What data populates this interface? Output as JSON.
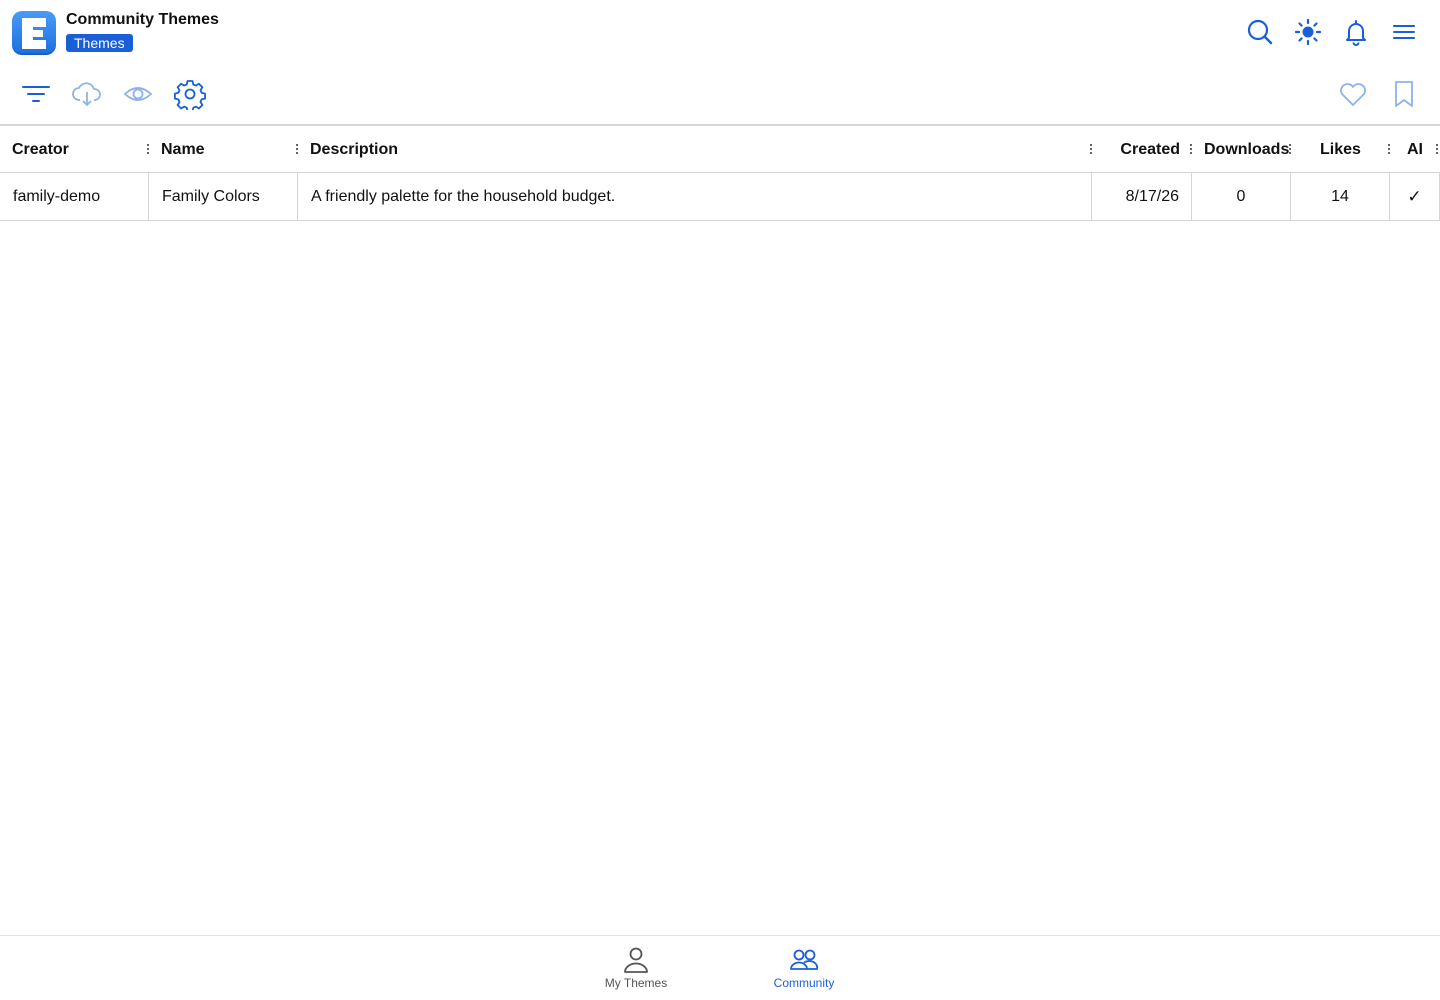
{
  "header": {
    "title": "Community Themes",
    "badge": "Themes",
    "icons": [
      "search-icon",
      "brightness-icon",
      "bell-icon",
      "hamburger-menu-icon"
    ]
  },
  "toolbar": {
    "left_icons": [
      "filter-icon",
      "cloud-download-icon",
      "eye-icon",
      "gear-icon"
    ],
    "right_icons": [
      "heart-icon",
      "bookmark-icon"
    ]
  },
  "table": {
    "columns": [
      "Creator",
      "Name",
      "Description",
      "Created",
      "Downloads",
      "Likes",
      "AI"
    ],
    "rows": [
      {
        "creator": "family-demo",
        "name": "Family Colors",
        "description": "A friendly palette for the household budget.",
        "created": "8/17/26",
        "downloads": "0",
        "likes": "14",
        "ai": "✓"
      }
    ]
  },
  "bottom_nav": {
    "items": [
      {
        "label": "My Themes",
        "icon": "person-icon",
        "active": false
      },
      {
        "label": "Community",
        "icon": "people-icon",
        "active": true
      }
    ]
  },
  "colors": {
    "accent": "#1a5fd8",
    "icon_active": "#1a5fd8",
    "icon_disabled": "#8db2ec",
    "border": "#d6d6d6",
    "inactive_nav": "#555555"
  }
}
